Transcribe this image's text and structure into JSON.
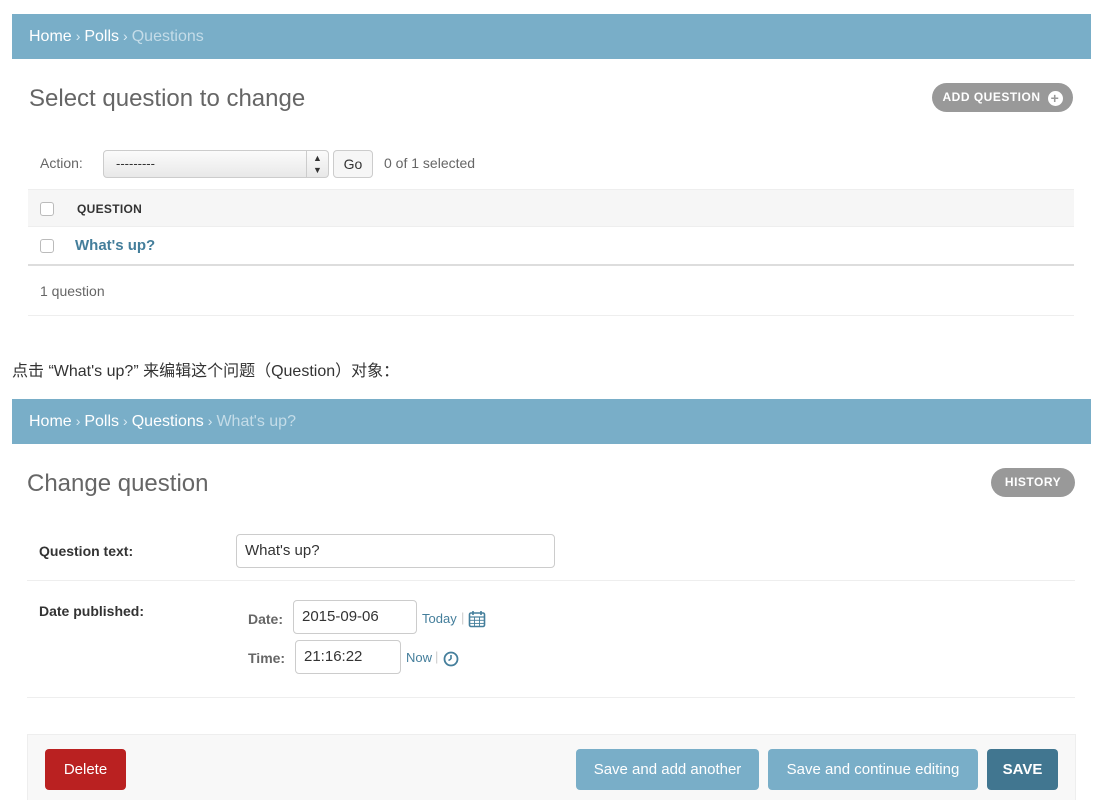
{
  "list_page": {
    "breadcrumbs": [
      "Home",
      "Polls",
      "Questions"
    ],
    "title": "Select question to change",
    "add_button": "ADD QUESTION",
    "action_label": "Action:",
    "action_value": "---------",
    "go_label": "Go",
    "selected_text": "0 of 1 selected",
    "column_header": "QUESTION",
    "rows": [
      "What's up?"
    ],
    "paginator": "1 question"
  },
  "caption": "点击 “What's up?” 来编辑这个问题（Question）对象：",
  "change_page": {
    "breadcrumbs": [
      "Home",
      "Polls",
      "Questions",
      "What's up?"
    ],
    "title": "Change question",
    "history_button": "HISTORY",
    "question_text_label": "Question text:",
    "question_text_value": "What's up?",
    "date_published_label": "Date published:",
    "date_label": "Date:",
    "date_value": "2015-09-06",
    "today_link": "Today",
    "time_label": "Time:",
    "time_value": "21:16:22",
    "now_link": "Now",
    "shortcut_separator": "|",
    "delete_button": "Delete",
    "save_add_another": "Save and add another",
    "save_continue": "Save and continue editing",
    "save_button": "SAVE"
  },
  "colors": {
    "header_bar": "#79aec8",
    "link": "#447e9b",
    "delete": "#ba2121",
    "save": "#417690"
  },
  "icons": {
    "add": "plus-icon",
    "calendar": "calendar-icon",
    "clock": "clock-icon"
  }
}
